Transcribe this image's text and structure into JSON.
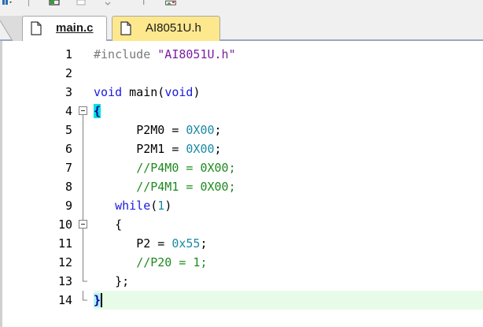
{
  "tabs": [
    {
      "label": "main.c",
      "active": true
    },
    {
      "label": "AI8051U.h",
      "active": false
    }
  ],
  "lines": [
    {
      "num": "1",
      "fold": ""
    },
    {
      "num": "2",
      "fold": ""
    },
    {
      "num": "3",
      "fold": ""
    },
    {
      "num": "4",
      "fold": "minus"
    },
    {
      "num": "5",
      "fold": "bar"
    },
    {
      "num": "6",
      "fold": "bar"
    },
    {
      "num": "7",
      "fold": "bar"
    },
    {
      "num": "8",
      "fold": "bar"
    },
    {
      "num": "9",
      "fold": "bar"
    },
    {
      "num": "10",
      "fold": "minus"
    },
    {
      "num": "11",
      "fold": "bar"
    },
    {
      "num": "12",
      "fold": "bar"
    },
    {
      "num": "13",
      "fold": "end"
    },
    {
      "num": "14",
      "fold": "end"
    }
  ],
  "code": {
    "l1_pp": "#include",
    "l1_str": "\"AI8051U.h\"",
    "l3_kw1": "void",
    "l3_fn": " main(",
    "l3_kw2": "void",
    "l3_close": ")",
    "l4_brace": "{",
    "l5_id": "P2M0 = ",
    "l5_num": "0X00",
    "l5_semi": ";",
    "l6_id": "P2M1 = ",
    "l6_num": "0X00",
    "l6_semi": ";",
    "l7_cm": "//P4M0 = 0X00;",
    "l8_cm": "//P4M1 = 0X00;",
    "l9_kw": "while",
    "l9_open": "(",
    "l9_num": "1",
    "l9_close": ")",
    "l10_brace": "{",
    "l11_id": "P2 = ",
    "l11_num": "0x55",
    "l11_semi": ";",
    "l12_cm": "//P20 = 1;",
    "l13_brace": "};",
    "l14_brace": "}"
  },
  "colors": {
    "keyword": "#1a1ae0",
    "string": "#7a1fa0",
    "number": "#1a8aa6",
    "comment": "#1f8a1f",
    "active_line": "#e8fbe8",
    "brace_match": "#00e0e0",
    "inactive_tab": "#fde88e"
  },
  "icons": [
    "toolbar-dropdown-icon",
    "toolbar-window-icon",
    "toolbar-blank-icon",
    "toolbar-arrow-icon",
    "toolbar-arrow-icon",
    "toolbar-image-icon",
    "document-icon"
  ]
}
